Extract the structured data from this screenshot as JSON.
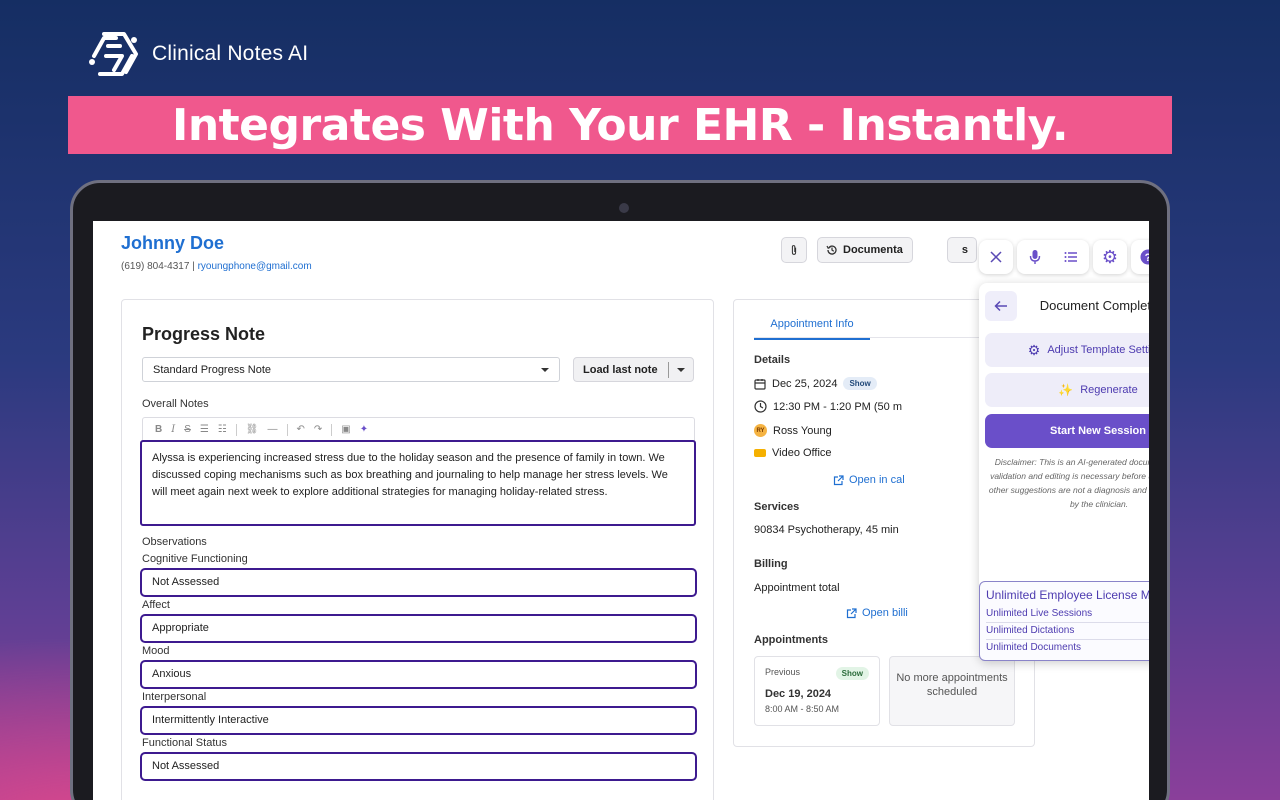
{
  "brand": {
    "name": "Clinical Notes AI",
    "logo_icon": "clinical-notes-logo"
  },
  "banner": {
    "headline": "Integrates With Your EHR - Instantly."
  },
  "patient": {
    "name": "Johnny Doe",
    "phone": "(619) 804-4317",
    "separator": "|",
    "email": "ryoungphone@gmail.com"
  },
  "toolbar": {
    "documents_label": "Documenta",
    "partial_label": "s"
  },
  "note": {
    "title": "Progress Note",
    "template": "Standard Progress Note",
    "load_last_label": "Load last note",
    "overall_label": "Overall Notes",
    "overall_text": "Alyssa is experiencing increased stress due to the holiday season and the presence of family in town. We discussed coping mechanisms such as box breathing and journaling to help manage her stress levels. We will meet again next week to explore additional strategies for managing holiday-related stress.",
    "observations_label": "Observations",
    "fields": [
      {
        "label": "Cognitive Functioning",
        "value": "Not Assessed"
      },
      {
        "label": "Affect",
        "value": "Appropriate"
      },
      {
        "label": "Mood",
        "value": "Anxious"
      },
      {
        "label": "Interpersonal",
        "value": "Intermittently Interactive"
      },
      {
        "label": "Functional Status",
        "value": "Not Assessed"
      }
    ]
  },
  "appointment": {
    "tab_label": "Appointment Info",
    "details_label": "Details",
    "date": "Dec 25, 2024",
    "status": "Show",
    "time": "12:30 PM - 1:20 PM (50 m",
    "clinician_initials": "RY",
    "clinician": "Ross Young",
    "location": "Video Office",
    "open_calendar": "Open in cal",
    "services_label": "Services",
    "service": "90834 Psychotherapy, 45 min",
    "billing_label": "Billing",
    "billing_total_label": "Appointment total",
    "open_billing": "Open billi",
    "appointments_label": "Appointments",
    "previous_label": "Previous",
    "previous_status": "Show",
    "previous_date": "Dec 19, 2024",
    "previous_time": "8:00 AM - 8:50 AM",
    "no_more": "No more appointments scheduled"
  },
  "ai_panel": {
    "title": "Document Complete",
    "adjust_label": "Adjust Template Settings",
    "regenerate_label": "Regenerate",
    "start_label": "Start New Session",
    "disclaimer": "Disclaimer: This is an AI-generated document. Clinician validation and editing is necessary before use. Codes and other suggestions are not a diagnosis and must be verified by the clinician.",
    "membership_title": "Unlimited Employee License Membership",
    "membership_items": [
      "Unlimited Live Sessions",
      "Unlimited Dictations",
      "Unlimited Documents"
    ]
  },
  "colors": {
    "banner": "#f0588d",
    "accent": "#6a4fc9",
    "link": "#1f6fd1",
    "highlight_border": "#3d1a8f"
  }
}
